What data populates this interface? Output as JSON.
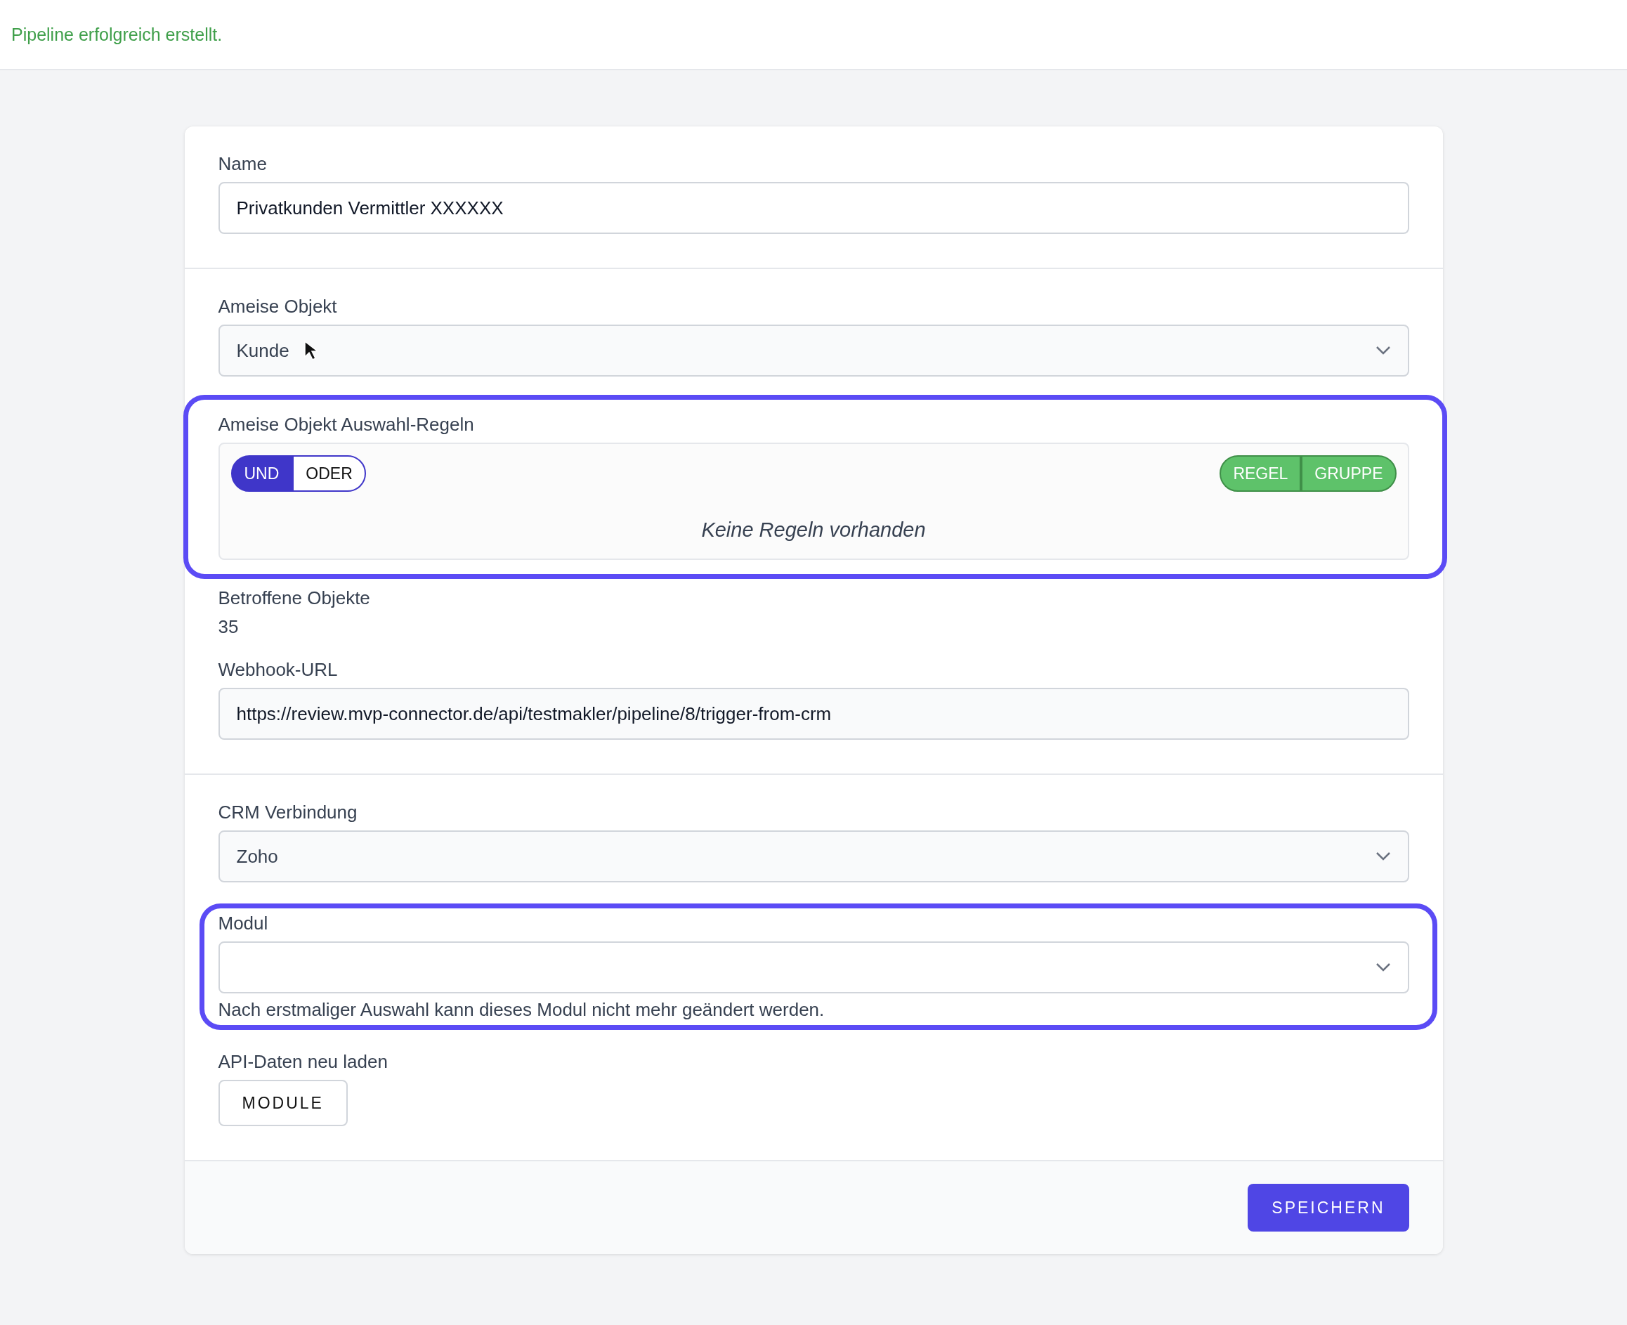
{
  "flash": {
    "message": "Pipeline erfolgreich erstellt."
  },
  "name_field": {
    "label": "Name",
    "value": "Privatkunden Vermittler XXXXXX"
  },
  "object_select": {
    "label": "Ameise Objekt",
    "value": "Kunde"
  },
  "rules": {
    "label": "Ameise Objekt Auswahl-Regeln",
    "highlighted": true,
    "combinators": [
      {
        "label": "UND",
        "selected": true
      },
      {
        "label": "ODER",
        "selected": false
      }
    ],
    "actions": [
      "REGEL",
      "GRUPPE"
    ],
    "empty_text": "Keine Regeln vorhanden"
  },
  "affected": {
    "label": "Betroffene Objekte",
    "value": "35"
  },
  "webhook": {
    "label": "Webhook-URL",
    "value": "https://review.mvp-connector.de/api/testmakler/pipeline/8/trigger-from-crm"
  },
  "crm_select": {
    "label": "CRM Verbindung",
    "value": "Zoho"
  },
  "module_select": {
    "label": "Modul",
    "highlighted": true,
    "help": "Nach erstmaliger Auswahl kann dieses Modul nicht mehr geändert werden."
  },
  "reload": {
    "label": "API-Daten neu laden",
    "button": "MODULE"
  },
  "save_button": "SPEICHERN"
}
